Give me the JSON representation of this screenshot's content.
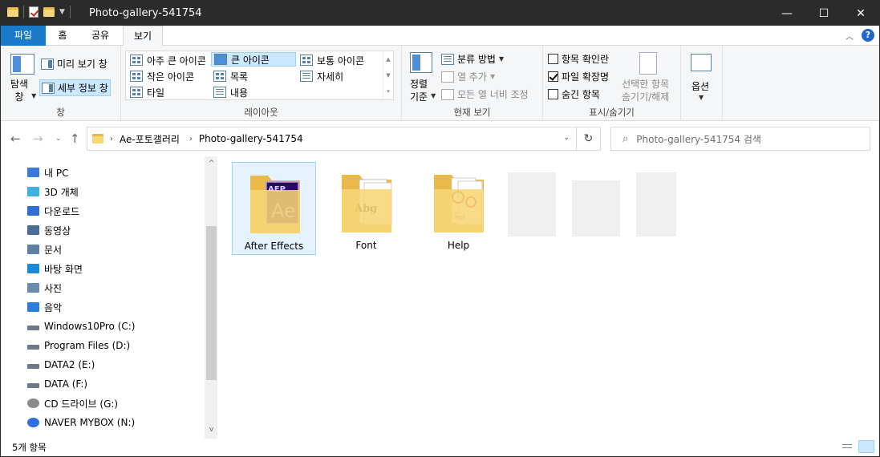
{
  "window": {
    "title": "Photo-gallery-541754",
    "controls": {
      "minimize": "—",
      "maximize": "☐",
      "close": "✕"
    }
  },
  "ribbon_tabs": [
    "파일",
    "홈",
    "공유",
    "보기"
  ],
  "ribbon": {
    "pane_group": {
      "label": "창",
      "nav_pane": "탐색\n창",
      "preview_pane": "미리 보기 창",
      "details_pane": "세부 정보 창"
    },
    "layout_group": {
      "label": "레이아웃",
      "items": [
        "아주 큰 아이콘",
        "큰 아이콘",
        "보통 아이콘",
        "작은 아이콘",
        "목록",
        "자세히",
        "타일",
        "내용"
      ],
      "selected": "큰 아이콘"
    },
    "current_view_group": {
      "label": "현재 보기",
      "sort_by": "정렬\n기준",
      "group_by": "분류 방법",
      "add_columns": "열 추가",
      "size_all_columns": "모든 열 너비 조정"
    },
    "show_hide_group": {
      "label": "표시/숨기기",
      "item_checkboxes": {
        "label": "항목 확인란",
        "checked": false
      },
      "file_extensions": {
        "label": "파일 확장명",
        "checked": true
      },
      "hidden_items": {
        "label": "숨긴 항목",
        "checked": false
      },
      "hide_selected": "선택한 항목\n숨기기/해제"
    },
    "options": {
      "label": "옵션"
    }
  },
  "address": {
    "crumbs": [
      "Ae-포토갤러리",
      "Photo-gallery-541754"
    ],
    "search_placeholder": "Photo-gallery-541754 검색"
  },
  "nav_pane": {
    "items": [
      {
        "label": "내 PC",
        "icon": "pc-icon",
        "color": "#3a7bd5"
      },
      {
        "label": "3D 개체",
        "icon": "3d-objects-icon",
        "color": "#3fb0e0"
      },
      {
        "label": "다운로드",
        "icon": "download-icon",
        "color": "#2f6fcf"
      },
      {
        "label": "동영상",
        "icon": "video-icon",
        "color": "#4a6d96"
      },
      {
        "label": "문서",
        "icon": "document-icon",
        "color": "#5f7fa3"
      },
      {
        "label": "바탕 화면",
        "icon": "desktop-icon",
        "color": "#1a8ad6"
      },
      {
        "label": "사진",
        "icon": "pictures-icon",
        "color": "#6a8bad"
      },
      {
        "label": "음악",
        "icon": "music-icon",
        "color": "#2b7fd6"
      },
      {
        "label": "Windows10Pro (C:)",
        "icon": "system-drive-icon",
        "color": "#6a7a8a"
      },
      {
        "label": "Program Files (D:)",
        "icon": "drive-icon",
        "color": "#6a7a8a"
      },
      {
        "label": "DATA2 (E:)",
        "icon": "drive-icon",
        "color": "#6a7a8a"
      },
      {
        "label": "DATA (F:)",
        "icon": "drive-icon",
        "color": "#6a7a8a"
      },
      {
        "label": "CD 드라이브 (G:)",
        "icon": "cd-drive-icon",
        "color": "#8a8a8a"
      },
      {
        "label": "NAVER MYBOX (N:)",
        "icon": "naver-mybox-icon",
        "color": "#2f6fe0"
      }
    ]
  },
  "files": [
    {
      "name": "After Effects",
      "overlay": "Ae",
      "tag": "AEP",
      "color": "#2a0a5c",
      "accent": "#a896ff",
      "selected": true
    },
    {
      "name": "Font",
      "overlay": "Abg",
      "tag": "",
      "color": "#222222",
      "accent": "#ffffff",
      "selected": false
    },
    {
      "name": "Help",
      "overlay": "PDF",
      "tag": "",
      "color": "#c62828",
      "accent": "#ffffff",
      "selected": false
    }
  ],
  "status": {
    "count": "5개 항목"
  }
}
